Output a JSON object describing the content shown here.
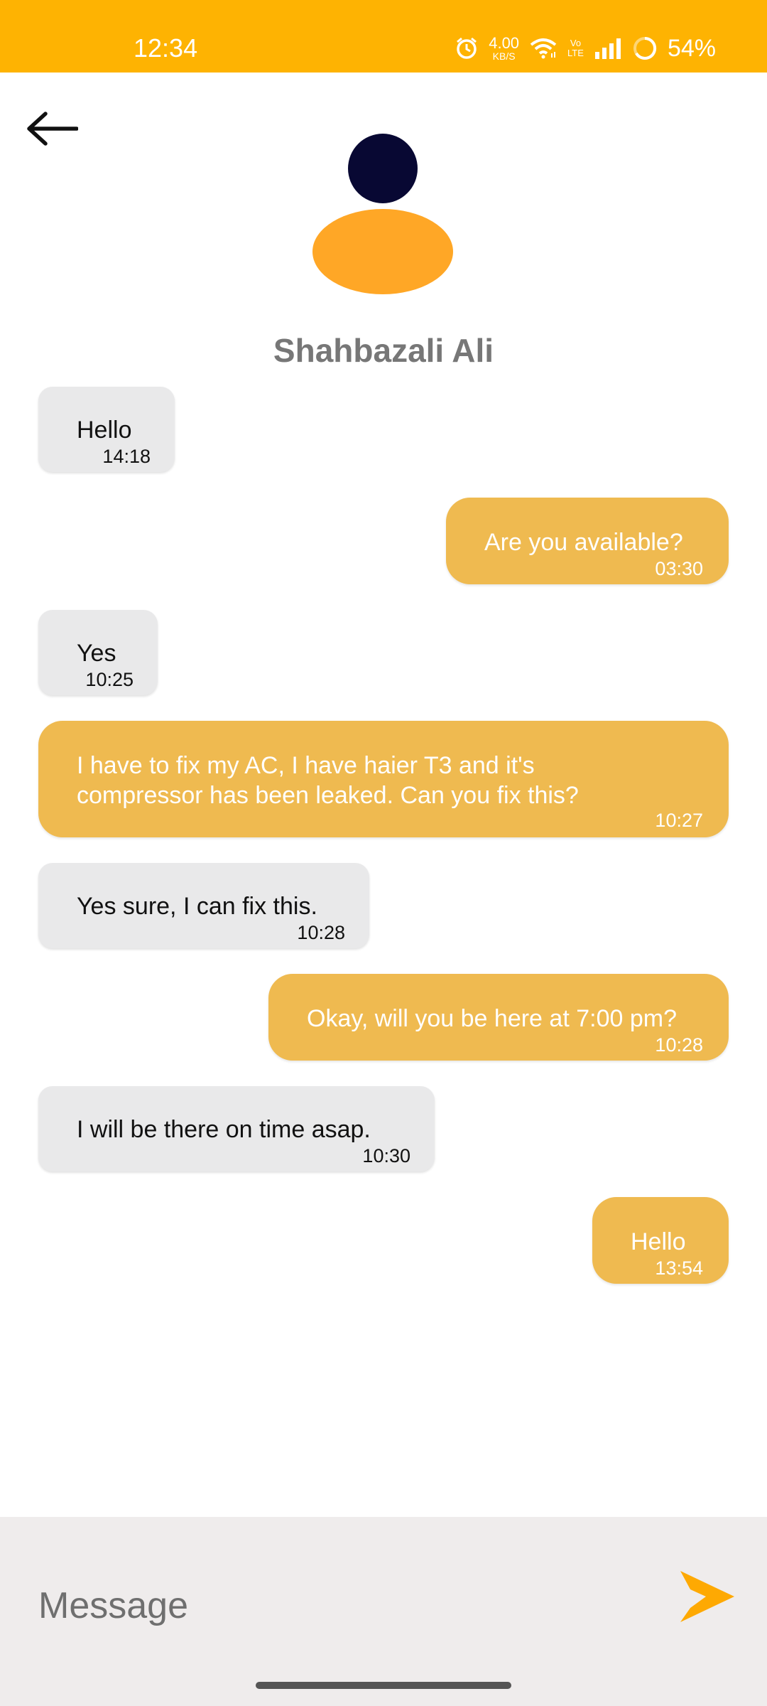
{
  "status_bar": {
    "time": "12:34",
    "net_speed_value": "4.00",
    "net_speed_unit": "KB/S",
    "volte_label": "Vo\nLTE",
    "battery_percent": "54%",
    "icons": [
      "alarm-icon",
      "wifi-icon",
      "volte-icon",
      "signal-icon",
      "battery-ring-icon"
    ],
    "color": "#FEB302"
  },
  "header": {
    "back_icon": "arrow-left-icon",
    "contact_name": "Shahbazali Ali",
    "avatar_colors": {
      "head": "#080833",
      "body": "#FFA726"
    }
  },
  "messages": [
    {
      "direction": "incoming",
      "text": [
        "Hello"
      ],
      "time": "14:18"
    },
    {
      "direction": "outgoing",
      "text": [
        "Are you available?"
      ],
      "time": "03:30"
    },
    {
      "direction": "incoming",
      "text": [
        "Yes"
      ],
      "time": "10:25"
    },
    {
      "direction": "outgoing",
      "text": [
        "I have to fix my AC, I have haier T3 and it's",
        "compressor has been leaked. Can you fix this?"
      ],
      "time": "10:27"
    },
    {
      "direction": "incoming",
      "text": [
        "Yes sure, I can fix this."
      ],
      "time": "10:28"
    },
    {
      "direction": "outgoing",
      "text": [
        "Okay, will you be here at 7:00 pm?"
      ],
      "time": "10:28"
    },
    {
      "direction": "incoming",
      "text": [
        "I will be there on time asap."
      ],
      "time": "10:30"
    },
    {
      "direction": "outgoing",
      "text": [
        "Hello"
      ],
      "time": "13:54"
    }
  ],
  "input": {
    "value": "",
    "placeholder": "Message",
    "send_icon": "send-icon"
  },
  "colors": {
    "accent": "#FEB302",
    "outgoing_bubble": "#EFBA50",
    "incoming_bubble": "#E9E9EA",
    "send_button": "#FEA902",
    "input_bar": "#EFECEC"
  }
}
